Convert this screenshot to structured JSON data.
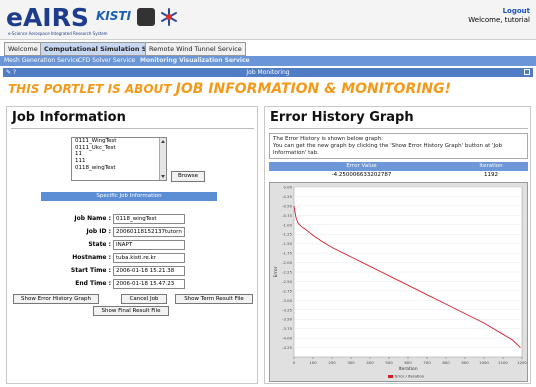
{
  "header": {
    "logo": "eAIRS",
    "logo_sub": "e-Science Aerospace Integrated Research System",
    "partner": "KISTI",
    "logout_label": "Logout",
    "welcome_text": "Welcome, tutorial"
  },
  "tabs": [
    {
      "label": "Welcome"
    },
    {
      "label": "Computational Simulation Service"
    },
    {
      "label": "Remote Wind Tunnel Service"
    }
  ],
  "subtabs": [
    {
      "label": "Mesh Generation Service"
    },
    {
      "label": "CFD Solver Service"
    },
    {
      "label": "Monitoring Visualization Service"
    }
  ],
  "portlet": {
    "title": "Job Monitoring",
    "banner_prefix": "THIS PORTLET IS ABOUT ",
    "banner_highlight": "JOB INFORMATION & MONITORING!"
  },
  "job_info": {
    "title": "Job Information",
    "job_list": [
      "0111_WingTest",
      "0111_Ukc_Test",
      "11",
      "111",
      "0118_wingTest"
    ],
    "browse_label": "Browse",
    "specific_header": "Specific Job Information",
    "fields": [
      {
        "label": "Job Name :",
        "value": "0118_wingTest"
      },
      {
        "label": "Job ID :",
        "value": "20060118152137tutorn"
      },
      {
        "label": "State :",
        "value": "INAPT"
      },
      {
        "label": "Hostname :",
        "value": "tuba.kisti.re.kr"
      },
      {
        "label": "Start Time :",
        "value": "2006-01-18 15.21.38"
      },
      {
        "label": "End Time :",
        "value": "2006-01-18 15.47.23"
      }
    ],
    "buttons": {
      "show_error_history": "Show Error History Graph",
      "cancel_job": "Cancel Job",
      "show_term_result": "Show Term Result File",
      "show_final_result": "Show Final Result File"
    }
  },
  "error_graph": {
    "title": "Error History Graph",
    "description_line1": "The Error History is shown below graph.",
    "description_line2": "You can get the new graph by clicking the 'Show Error History Graph' button at 'Job Information' tab.",
    "table_headers": [
      "Error Value",
      "Iteration"
    ],
    "table_row": [
      "-4.250006633202787",
      "1192"
    ]
  },
  "chart_data": {
    "type": "line",
    "xlabel": "Iteration",
    "ylabel": "Error",
    "xlim": [
      0,
      1200
    ],
    "ylim": [
      -4.5,
      0
    ],
    "x_ticks": [
      "0",
      "100",
      "200",
      "300",
      "400",
      "500",
      "600",
      "700",
      "800",
      "900",
      "1000",
      "1100",
      "1200"
    ],
    "y_ticks": [
      "0.00",
      "-0.25",
      "-0.50",
      "-0.75",
      "-1.00",
      "-1.25",
      "-1.50",
      "-1.75",
      "-2.00",
      "-2.25",
      "-2.50",
      "-2.75",
      "-3.00",
      "-3.25",
      "-3.50",
      "-3.75",
      "-4.00",
      "-4.25"
    ],
    "series": [
      {
        "name": "Error / Iteration",
        "color": "#d0202a",
        "x": [
          0,
          10,
          20,
          40,
          60,
          80,
          100,
          150,
          200,
          300,
          400,
          500,
          600,
          700,
          800,
          900,
          1000,
          1050,
          1100,
          1150,
          1192
        ],
        "y": [
          -0.5,
          -0.8,
          -0.95,
          -1.05,
          -1.12,
          -1.2,
          -1.28,
          -1.45,
          -1.6,
          -1.85,
          -2.1,
          -2.35,
          -2.6,
          -2.85,
          -3.1,
          -3.35,
          -3.6,
          -3.75,
          -3.9,
          -4.05,
          -4.25
        ]
      }
    ]
  }
}
